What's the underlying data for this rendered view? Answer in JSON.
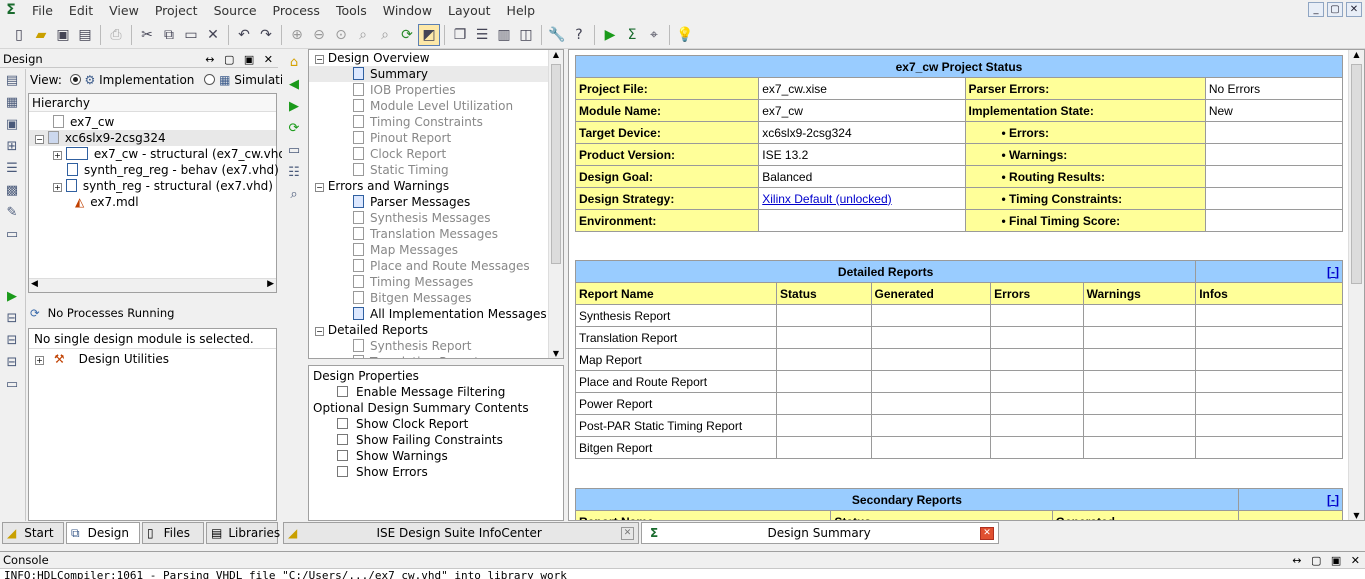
{
  "menu": [
    "File",
    "Edit",
    "View",
    "Project",
    "Source",
    "Process",
    "Tools",
    "Window",
    "Layout",
    "Help"
  ],
  "win_controls": [
    "_",
    "▢",
    "✕"
  ],
  "design_panel": {
    "title": "Design",
    "controls": "↔ ▢ ▣ ✕",
    "view_label": "View:",
    "implementation_label": "Implementation",
    "simulation_label": "Simulation",
    "hierarchy_label": "Hierarchy",
    "hierarchy": [
      {
        "text": "ex7_cw",
        "indent": 0
      },
      {
        "text": "xc6slx9-2csg324",
        "indent": 0
      },
      {
        "text": "ex7_cw - structural (ex7_cw.vhd)",
        "indent": 1
      },
      {
        "text": "synth_reg_reg - behav (ex7.vhd)",
        "indent": 1
      },
      {
        "text": "synth_reg - structural (ex7.vhd)",
        "indent": 1
      },
      {
        "text": "ex7.mdl",
        "indent": 1
      }
    ],
    "processes_status": "No Processes Running",
    "no_module_msg": "No single design module is selected.",
    "design_utilities": "Design Utilities"
  },
  "summary_nav": {
    "groups": [
      {
        "title": "Design Overview",
        "items": [
          {
            "label": "Summary",
            "active": true
          },
          {
            "label": "IOB Properties",
            "active": false
          },
          {
            "label": "Module Level Utilization",
            "active": false
          },
          {
            "label": "Timing Constraints",
            "active": false
          },
          {
            "label": "Pinout Report",
            "active": false
          },
          {
            "label": "Clock Report",
            "active": false
          },
          {
            "label": "Static Timing",
            "active": false
          }
        ]
      },
      {
        "title": "Errors and Warnings",
        "items": [
          {
            "label": "Parser Messages",
            "active": true
          },
          {
            "label": "Synthesis Messages",
            "active": false
          },
          {
            "label": "Translation Messages",
            "active": false
          },
          {
            "label": "Map Messages",
            "active": false
          },
          {
            "label": "Place and Route Messages",
            "active": false
          },
          {
            "label": "Timing Messages",
            "active": false
          },
          {
            "label": "Bitgen Messages",
            "active": false
          },
          {
            "label": "All Implementation Messages",
            "active": true
          }
        ]
      },
      {
        "title": "Detailed Reports",
        "items": [
          {
            "label": "Synthesis Report",
            "active": false
          },
          {
            "label": "Translation Report",
            "active": false
          }
        ]
      }
    ]
  },
  "design_properties": {
    "title": "Design Properties",
    "enable_filtering": "Enable Message Filtering",
    "optional_title": "Optional Design Summary Contents",
    "options": [
      "Show Clock Report",
      "Show Failing Constraints",
      "Show Warnings",
      "Show Errors"
    ]
  },
  "project_status": {
    "title": "ex7_cw Project Status",
    "rows": [
      [
        "Project File:",
        "ex7_cw.xise",
        "Parser Errors:",
        "No Errors"
      ],
      [
        "Module Name:",
        "ex7_cw",
        "Implementation State:",
        "New"
      ],
      [
        "Target Device:",
        "xc6slx9-2csg324",
        "• Errors:",
        ""
      ],
      [
        "Product Version:",
        "ISE 13.2",
        "• Warnings:",
        ""
      ],
      [
        "Design Goal:",
        "Balanced",
        "• Routing Results:",
        ""
      ],
      [
        "Design Strategy:",
        "Xilinx Default (unlocked)",
        "• Timing Constraints:",
        ""
      ],
      [
        "Environment:",
        "",
        "• Final Timing Score:",
        ""
      ]
    ]
  },
  "detailed_reports": {
    "title": "Detailed Reports",
    "toggle": "[-]",
    "columns": [
      "Report Name",
      "Status",
      "Generated",
      "Errors",
      "Warnings",
      "Infos"
    ],
    "rows": [
      "Synthesis Report",
      "Translation Report",
      "Map Report",
      "Place and Route Report",
      "Power Report",
      "Post-PAR Static Timing Report",
      "Bitgen Report"
    ]
  },
  "secondary_reports": {
    "title": "Secondary Reports",
    "toggle": "[-]",
    "columns": [
      "Report Name",
      "Status",
      "Generated"
    ]
  },
  "bottom_tabs": {
    "left": [
      "Start",
      "Design",
      "Files",
      "Libraries"
    ],
    "doc_tabs": [
      "ISE Design Suite InfoCenter",
      "Design Summary"
    ]
  },
  "console": {
    "title": "Console",
    "controls": "↔ ▢ ▣ ✕",
    "line": "INFO:HDLCompiler:1061 - Parsing VHDL file \"C:/Users/.../ex7_cw.vhd\" into library work"
  }
}
